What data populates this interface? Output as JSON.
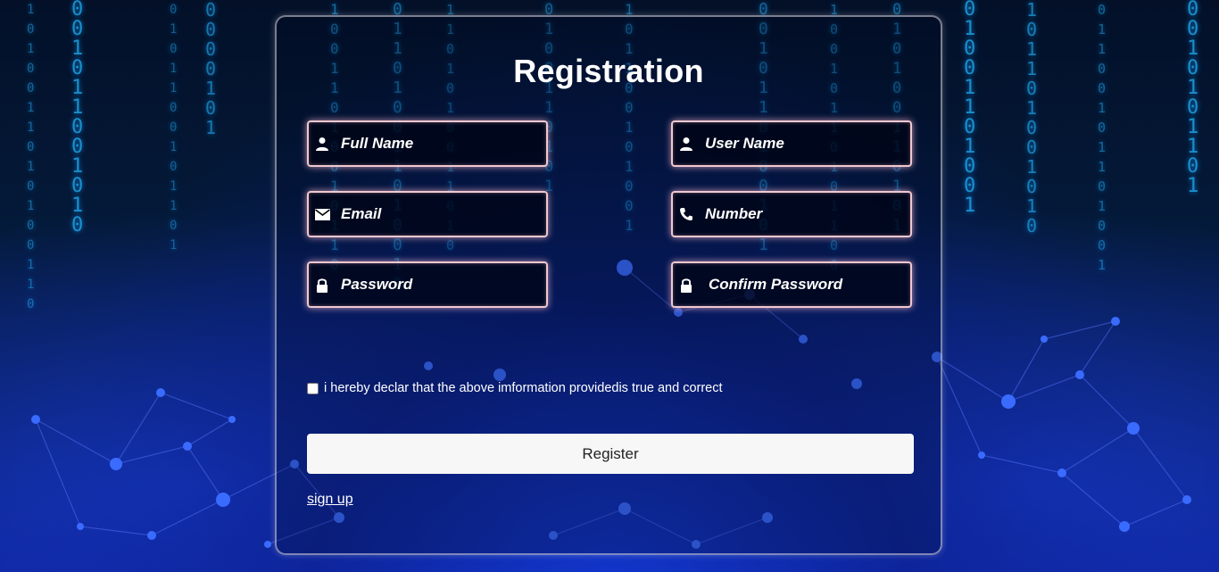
{
  "form": {
    "title": "Registration",
    "fields": {
      "full_name": {
        "placeholder": "Full Name",
        "icon": "user-icon"
      },
      "user_name": {
        "placeholder": "User Name",
        "icon": "user-icon"
      },
      "email": {
        "placeholder": "Email",
        "icon": "envelope-icon"
      },
      "number": {
        "placeholder": "Number",
        "icon": "phone-icon"
      },
      "password": {
        "placeholder": "Password",
        "icon": "lock-icon"
      },
      "confirm_password": {
        "placeholder": "Confirm Password",
        "icon": "lock-icon"
      }
    },
    "declaration": {
      "label": "i hereby declar that the above imformation providedis true and correct",
      "checked": false
    },
    "register_label": "Register",
    "signup_label": "sign up"
  },
  "colors": {
    "field_border": "#f0c8d0",
    "button_bg": "#f7f7f7",
    "text": "#ffffff",
    "background_accent": "#1a3ce0",
    "code_rain": "#22b8ff"
  }
}
